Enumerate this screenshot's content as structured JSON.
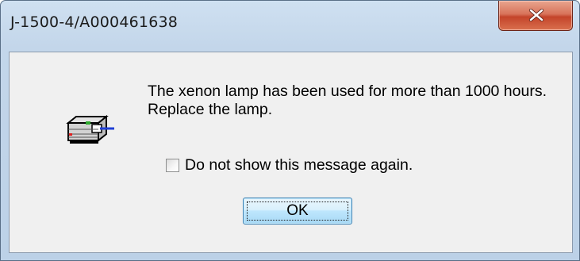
{
  "window": {
    "title": "J-1500-4/A000461638",
    "close_icon": "close-x-icon"
  },
  "dialog": {
    "icon": "lamp-module-icon",
    "message": "The xenon lamp has been used for more than 1000 hours. Replace the lamp.",
    "checkbox": {
      "label": "Do not show this message again.",
      "checked": false
    },
    "ok_label": "OK"
  },
  "colors": {
    "close_button": "#c4442a",
    "title_bar": "#c3d6ea",
    "client_background": "#f0f0f0",
    "ok_button_border": "#3c7fb1"
  }
}
